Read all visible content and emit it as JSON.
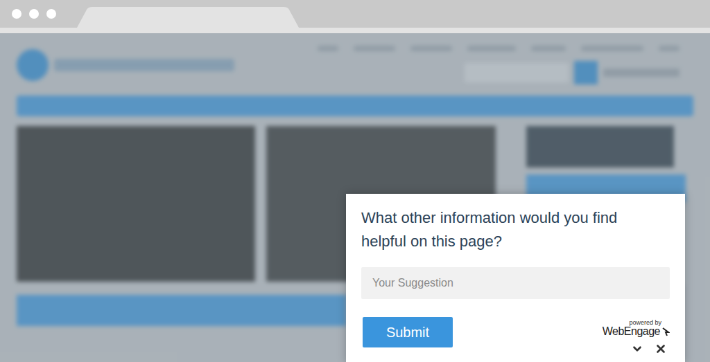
{
  "popup": {
    "question": "What other information would you find helpful on this page?",
    "input": {
      "placeholder": "Your Suggestion"
    },
    "submit": "Submit",
    "branding": {
      "caption": "powered by",
      "logo": "WebEngage"
    }
  }
}
